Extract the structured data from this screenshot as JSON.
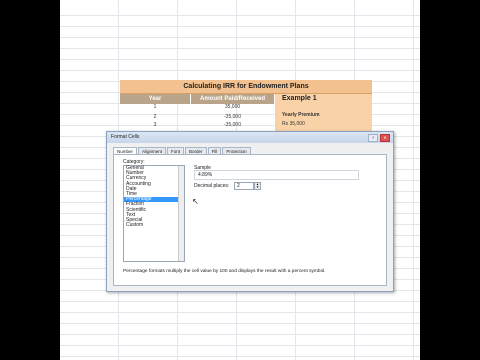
{
  "sheet": {
    "title": "Calculating IRR for Endowment Plans",
    "col_year": "Year",
    "col_amount": "Amount Paid/Received",
    "rows": [
      {
        "year": "1",
        "amount": "35,000"
      },
      {
        "year": "2",
        "amount": "-35,000"
      },
      {
        "year": "3",
        "amount": "-35,000"
      }
    ],
    "example_title": "Example 1",
    "example_line1": "Yearly Premium",
    "example_line2": "Rs 35,000"
  },
  "dialog": {
    "title": "Format Cells",
    "tabs": [
      "Number",
      "Alignment",
      "Font",
      "Border",
      "Fill",
      "Protection"
    ],
    "category_label": "Category:",
    "categories": [
      "General",
      "Number",
      "Currency",
      "Accounting",
      "Date",
      "Time",
      "Percentage",
      "Fraction",
      "Scientific",
      "Text",
      "Special",
      "Custom"
    ],
    "selected_category": "Percentage",
    "sample_label": "Sample",
    "sample_value": "4.89%",
    "decimal_label": "Decimal places:",
    "decimal_value": "2",
    "description": "Percentage formats multiply the cell value by 100 and displays the result with a percent symbol."
  }
}
